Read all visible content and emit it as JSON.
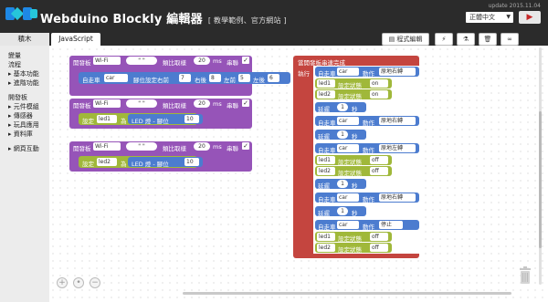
{
  "app": {
    "title": "Webduino Blockly 編輯器",
    "subtitle": "[ 教學範例、官方網站 ]",
    "update": "update 2015.11.04",
    "language": "正體中文",
    "run_icon": "play-icon"
  },
  "tabs": {
    "blocks": "積木",
    "javascript": "JavaScript"
  },
  "toolbar": {
    "code_edit": "程式編輯",
    "icons": [
      "code-icon",
      "flash-icon",
      "flask-icon",
      "trash-icon",
      "link-icon"
    ]
  },
  "sidebar": {
    "items": [
      "變量",
      "流程",
      "▸ 基本功能",
      "▸ 進階功能",
      "開發板",
      "▸ 元件模組",
      "▸ 傳感器",
      "▸ 玩具應用",
      "▸ 資料庫",
      "▸ 網頁互動"
    ]
  },
  "blocks": {
    "board_label": "開發板",
    "wifi": "Wi-Fi",
    "quote": "\" \"",
    "sampling": "類比取樣",
    "ms": "ms",
    "serial": "串聯",
    "sampling_value": "20",
    "car_label": "自走車",
    "car_var": "car",
    "car_pins": "腳位設定右前",
    "pin1": "7",
    "right_back": "右後",
    "pin2": "8",
    "left_front": "左前",
    "pin3": "5",
    "left_back": "左後",
    "pin4": "6",
    "set_label": "設定",
    "led1_var": "led1",
    "led2_var": "led2",
    "as": "為",
    "led": "LED 燈 - 腳位",
    "led1_pin": "10",
    "led2_pin": "10",
    "on_ready": "當開發板串連完成",
    "execute": "執行",
    "car_action": "動作",
    "delay": "延遲",
    "sec": "秒",
    "delay_value": "1",
    "set_state": "設定狀態",
    "on": "on",
    "off": "off",
    "act_turn_right": "原地右轉",
    "act_turn_left": "原地左轉",
    "act_stop": "停止"
  }
}
